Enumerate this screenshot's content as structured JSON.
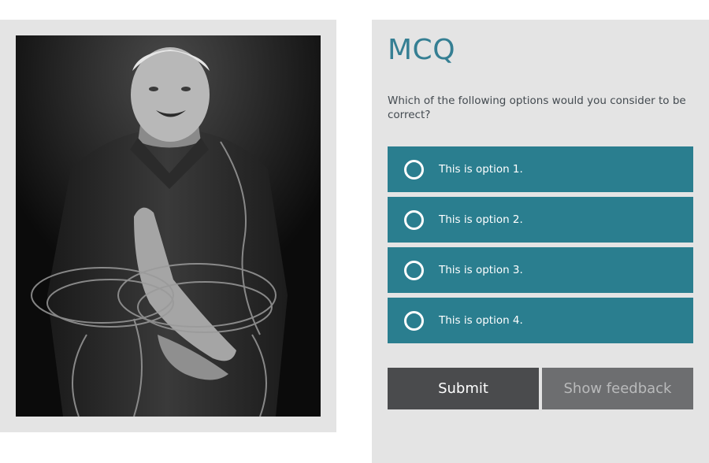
{
  "graphic": {
    "description_icon": "person-holding-rope-photo"
  },
  "mcq": {
    "title": "MCQ",
    "question": "Which of the following options would you consider to be correct?",
    "options": [
      {
        "label": "This is option 1.",
        "selected": false
      },
      {
        "label": "This is option 2.",
        "selected": false
      },
      {
        "label": "This is option 3.",
        "selected": false
      },
      {
        "label": "This is option 4.",
        "selected": false
      }
    ],
    "submit_label": "Submit",
    "feedback_label": "Show feedback"
  },
  "colors": {
    "panel_bg": "#e4e4e4",
    "title": "#357f93",
    "option_bg": "#2a7e8f",
    "submit_bg": "#4a4b4d",
    "feedback_bg": "#6d6e70"
  }
}
